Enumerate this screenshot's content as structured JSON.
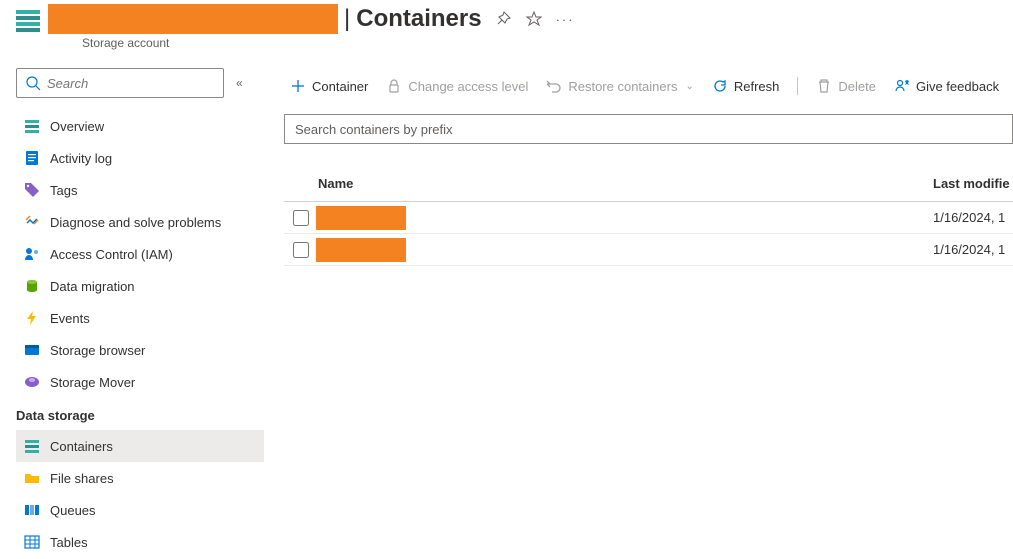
{
  "header": {
    "section_title": "Containers",
    "subtitle": "Storage account"
  },
  "sidebar": {
    "search_placeholder": "Search",
    "items_top": [
      {
        "label": "Overview",
        "icon": "overview"
      },
      {
        "label": "Activity log",
        "icon": "activity"
      },
      {
        "label": "Tags",
        "icon": "tags"
      },
      {
        "label": "Diagnose and solve problems",
        "icon": "diagnose"
      },
      {
        "label": "Access Control (IAM)",
        "icon": "iam"
      },
      {
        "label": "Data migration",
        "icon": "migration"
      },
      {
        "label": "Events",
        "icon": "events"
      },
      {
        "label": "Storage browser",
        "icon": "browser"
      },
      {
        "label": "Storage Mover",
        "icon": "mover"
      }
    ],
    "section_header": "Data storage",
    "items_storage": [
      {
        "label": "Containers",
        "icon": "containers",
        "active": true
      },
      {
        "label": "File shares",
        "icon": "fileshares"
      },
      {
        "label": "Queues",
        "icon": "queues"
      },
      {
        "label": "Tables",
        "icon": "tables"
      }
    ]
  },
  "toolbar": {
    "add": "Container",
    "access": "Change access level",
    "restore": "Restore containers",
    "refresh": "Refresh",
    "delete": "Delete",
    "feedback": "Give feedback"
  },
  "filter": {
    "placeholder": "Search containers by prefix"
  },
  "table": {
    "col_name": "Name",
    "col_date": "Last modifie",
    "rows": [
      {
        "date": "1/16/2024, 1"
      },
      {
        "date": "1/16/2024, 1"
      }
    ]
  }
}
